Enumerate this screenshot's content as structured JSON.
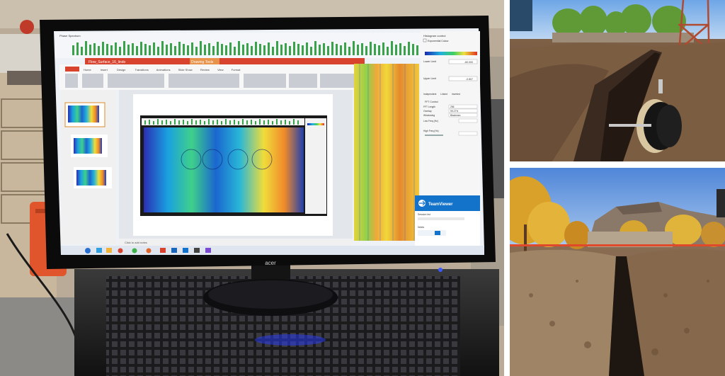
{
  "photo_lab": {
    "monitor_brand": "acer",
    "app_window_title": "Phase Spectrum",
    "file_title": "Flow_Surface_16_lindo",
    "ribbon_tabs": [
      "Home",
      "Insert",
      "Design",
      "Transitions",
      "Animations",
      "Slide Show",
      "Review",
      "View",
      "Format"
    ],
    "drawing_tools": "Drawing Tools",
    "notes_placeholder": "Click to add notes",
    "side_panel": {
      "header": "Histogram control",
      "exponential_colour": "Exponential Colour",
      "lower_limit_label": "Lower Limit",
      "lower_limit_value": "-60.000",
      "upper_limit_label": "Upper Limit",
      "upper_limit_value": "-0.807",
      "radio_options": [
        "Independent",
        "Linked",
        "Inverted"
      ],
      "fft_header": "FFT Control",
      "fft_length_label": "FFT Length",
      "fft_length_value": "256",
      "overlap_label": "Overlap",
      "overlap_value": "99.27%",
      "windowing_label": "Windowing",
      "windowing_value": "Blackman",
      "low_freq_label": "Low Freq (Hz)",
      "high_freq_label": "High Freq (Hz)"
    },
    "teamviewer": {
      "brand": "TeamViewer",
      "session_list": "Session list",
      "notes": "Notes"
    }
  },
  "photo_trench_reel": {
    "description_tag": "trench-with-cable-reel"
  },
  "photo_trench_mountain": {
    "description_tag": "trench-with-mesa"
  },
  "colors": {
    "divider": "#ffffff",
    "screen_blue": "#1f4fd6",
    "screen_yellow": "#f2e23a",
    "dirt": "#7a5a3e",
    "sky": "#7fb2ea"
  }
}
